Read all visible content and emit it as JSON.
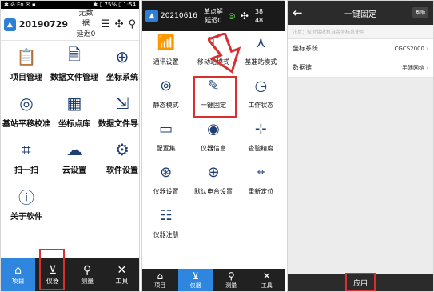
{
  "panel1": {
    "statusbar": {
      "left": "✱ ⊘ Fn ✉ ▪",
      "right": "✱ ▯ 75% ▯ 1:54"
    },
    "header": {
      "date": "20190729",
      "status_line1": "无数据",
      "status_line2": "延迟0"
    },
    "grid": [
      {
        "label": "项目管理",
        "icon": "clipboard-icon"
      },
      {
        "label": "数据文件管理",
        "icon": "document-icon"
      },
      {
        "label": "坐标系统",
        "icon": "globe-icon"
      },
      {
        "label": "基站平移校准",
        "icon": "target-icon"
      },
      {
        "label": "坐标点库",
        "icon": "grid-icon"
      },
      {
        "label": "数据文件导出",
        "icon": "export-icon"
      },
      {
        "label": "扫一扫",
        "icon": "scan-icon"
      },
      {
        "label": "云设置",
        "icon": "cloud-gear-icon"
      },
      {
        "label": "软件设置",
        "icon": "settings-icon"
      },
      {
        "label": "关于软件",
        "icon": "info-icon"
      }
    ],
    "tabs": [
      {
        "label": "项目",
        "icon": "home-icon"
      },
      {
        "label": "仪器",
        "icon": "instrument-icon"
      },
      {
        "label": "测量",
        "icon": "pin-icon"
      },
      {
        "label": "工具",
        "icon": "tools-icon"
      }
    ]
  },
  "panel2": {
    "header": {
      "date": "20210616",
      "status_line1": "单点解",
      "status_line2": "延迟0",
      "count_top": "38",
      "count_bottom": "48"
    },
    "grid": [
      {
        "label": "通讯设置"
      },
      {
        "label": "移动站模式"
      },
      {
        "label": "基准站模式"
      },
      {
        "label": "静态模式"
      },
      {
        "label": "一键固定"
      },
      {
        "label": "工作状态"
      },
      {
        "label": "配置集"
      },
      {
        "label": "仪器信息"
      },
      {
        "label": "查验精度"
      },
      {
        "label": "仪器设置"
      },
      {
        "label": "默认电台设置"
      },
      {
        "label": "重新定位"
      },
      {
        "label": "仪器注册"
      }
    ],
    "tabs": [
      {
        "label": "项目"
      },
      {
        "label": "仪器"
      },
      {
        "label": "测量"
      },
      {
        "label": "工具"
      }
    ]
  },
  "panel3": {
    "header": {
      "title": "一键固定",
      "help": "帮助"
    },
    "search_placeholder": "注意：仅对接收机自带坐标系使用",
    "rows": [
      {
        "label": "坐标系统",
        "value": "CGCS2000"
      },
      {
        "label": "数据链",
        "value": "手簿网络"
      }
    ],
    "apply_label": "应用"
  },
  "colors": {
    "accent": "#2e86de",
    "highlight": "#d63031",
    "tabbar": "#212121",
    "icon": "#1d3f73"
  }
}
